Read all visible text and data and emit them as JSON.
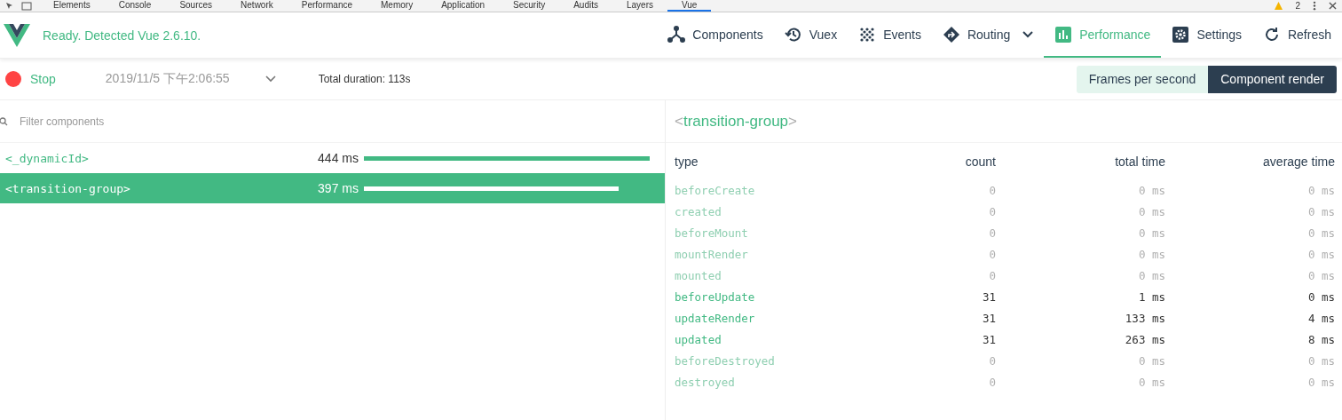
{
  "devtools_tabs": [
    {
      "label": "Elements",
      "selected": false
    },
    {
      "label": "Console",
      "selected": false
    },
    {
      "label": "Sources",
      "selected": false
    },
    {
      "label": "Network",
      "selected": false
    },
    {
      "label": "Performance",
      "selected": false
    },
    {
      "label": "Memory",
      "selected": false
    },
    {
      "label": "Application",
      "selected": false
    },
    {
      "label": "Security",
      "selected": false
    },
    {
      "label": "Audits",
      "selected": false
    },
    {
      "label": "Layers",
      "selected": false
    },
    {
      "label": "Vue",
      "selected": true
    }
  ],
  "warning_count": "2",
  "status": "Ready. Detected Vue 2.6.10.",
  "nav": [
    {
      "label": "Components",
      "kind": "tab",
      "selected": false
    },
    {
      "label": "Vuex",
      "kind": "tab",
      "selected": false
    },
    {
      "label": "Events",
      "kind": "tab",
      "selected": false
    },
    {
      "label": "Routing",
      "kind": "dropdown",
      "selected": false
    },
    {
      "label": "Performance",
      "kind": "tab",
      "selected": true
    },
    {
      "label": "Settings",
      "kind": "tab",
      "selected": false
    },
    {
      "label": "Refresh",
      "kind": "action",
      "selected": false
    }
  ],
  "toolbar": {
    "record_label": "Stop",
    "recording": true,
    "session": "2019/11/5 下午2:06:55",
    "total_duration": "Total duration: 113s",
    "modes": [
      {
        "label": "Frames per second",
        "selected": false
      },
      {
        "label": "Component render",
        "selected": true
      }
    ]
  },
  "filter": {
    "placeholder": "Filter components"
  },
  "components": [
    {
      "name": "<_dynamicId>",
      "time": "444 ms",
      "level": 1.0,
      "selected": false
    },
    {
      "name": "<transition-group>",
      "time": "397 ms",
      "level": 0.89,
      "selected": true
    }
  ],
  "detail": {
    "open": "<",
    "name": "transition-group",
    "close": ">",
    "columns": [
      "type",
      "count",
      "total time",
      "average time"
    ],
    "rows": [
      {
        "type": "beforeCreate",
        "count": "0",
        "total": "0 ms",
        "average": "0 ms",
        "disabled": true
      },
      {
        "type": "created",
        "count": "0",
        "total": "0 ms",
        "average": "0 ms",
        "disabled": true
      },
      {
        "type": "beforeMount",
        "count": "0",
        "total": "0 ms",
        "average": "0 ms",
        "disabled": true
      },
      {
        "type": "mountRender",
        "count": "0",
        "total": "0 ms",
        "average": "0 ms",
        "disabled": true
      },
      {
        "type": "mounted",
        "count": "0",
        "total": "0 ms",
        "average": "0 ms",
        "disabled": true
      },
      {
        "type": "beforeUpdate",
        "count": "31",
        "total": "1 ms",
        "average": "0 ms",
        "disabled": false
      },
      {
        "type": "updateRender",
        "count": "31",
        "total": "133 ms",
        "average": "4 ms",
        "disabled": false
      },
      {
        "type": "updated",
        "count": "31",
        "total": "263 ms",
        "average": "8 ms",
        "disabled": false
      },
      {
        "type": "beforeDestroyed",
        "count": "0",
        "total": "0 ms",
        "average": "0 ms",
        "disabled": true
      },
      {
        "type": "destroyed",
        "count": "0",
        "total": "0 ms",
        "average": "0 ms",
        "disabled": true
      }
    ]
  }
}
